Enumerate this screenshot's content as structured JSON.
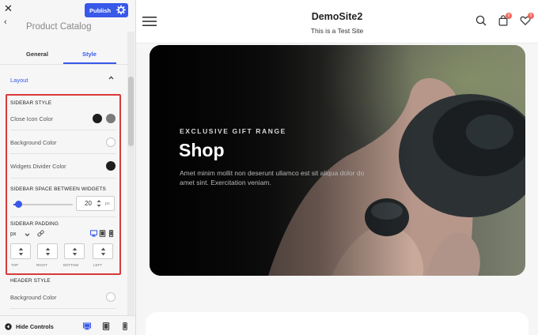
{
  "customizer": {
    "close_icon": "close-icon",
    "publish_label": "Publish",
    "settings_icon": "gear-icon",
    "panel_title": "Product Catalog",
    "tabs": [
      {
        "label": "General",
        "active": false
      },
      {
        "label": "Style",
        "active": true
      }
    ],
    "section_label": "Layout",
    "sidebar_style": {
      "heading": "SIDEBAR STYLE",
      "close_icon_color": {
        "label": "Close Icon Color",
        "colors": [
          "#1e1e1e",
          "#7a7a7a"
        ]
      },
      "background_color": {
        "label": "Background Color"
      },
      "widgets_divider_color": {
        "label": "Widgets Divider Color",
        "color": "#1e1e1e"
      }
    },
    "space_between_widgets": {
      "heading": "SIDEBAR SPACE BETWEEN WIDGETS",
      "value": "20",
      "unit": "px"
    },
    "padding": {
      "heading": "SIDEBAR PADDING",
      "unit": "px",
      "sides": [
        "TOP",
        "RIGHT",
        "BOTTOM",
        "LEFT"
      ]
    },
    "header_style": {
      "heading": "HEADER STYLE",
      "background_color": {
        "label": "Background Color"
      }
    },
    "footer": {
      "hide_label": "Hide Controls"
    },
    "accent_color": "#3858e9",
    "highlight_border_color": "#d9393a"
  },
  "site": {
    "title": "DemoSite2",
    "tagline": "This is a Test Site",
    "cart_count": "0",
    "wishlist_count": "0",
    "hero": {
      "eyebrow": "EXCLUSIVE GIFT RANGE",
      "title": "Shop",
      "text": "Amet minim mollit non deserunt ullamco est sit aliqua dolor do amet sint. Exercitation veniam."
    }
  }
}
